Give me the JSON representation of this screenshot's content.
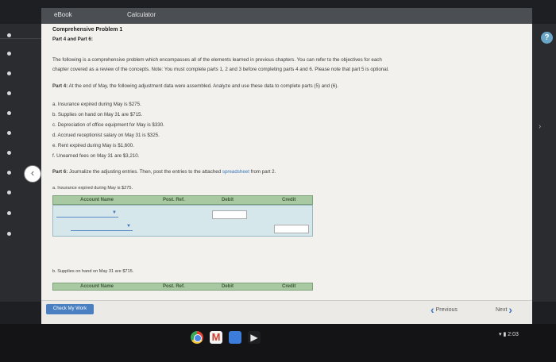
{
  "tabs": {
    "ebook": "eBook",
    "calculator": "Calculator"
  },
  "problem": {
    "title": "Comprehensive Problem 1",
    "subtitle": "Part 4 and Part 6:",
    "intro_line1": "The following is a comprehensive problem which encompasses all of the elements learned in previous chapters. You can refer to the objectives for each",
    "intro_line2": "chapter covered as a review of the concepts. Note: You must complete parts 1, 2 and 3 before completing parts 4 and 6. Please note that part 5 is optional.",
    "part4_label": "Part 4:",
    "part4_text": "At the end of May, the following adjustment data were assembled. Analyze and use these data to complete parts (5) and (6).",
    "items": [
      "a. Insurance expired during May is $275.",
      "b. Supplies on hand on May 31 are $715.",
      "c. Depreciation of office equipment for May is $330.",
      "d. Accrued receptionist salary on May 31 is $325.",
      "e. Rent expired during May is $1,600.",
      "f. Unearned fees on May 31 are $3,210."
    ],
    "part6_label": "Part 6:",
    "part6_text": "Journalize the adjusting entries. Then, post the entries to the attached",
    "part6_link": "spreadsheet",
    "part6_tail": "from part 2.",
    "entry_a": "a.  Insurance expired during May is $275.",
    "entry_b": "b.  Supplies on hand on May 31 are $715."
  },
  "table": {
    "account_name": "Account Name",
    "post_ref": "Post. Ref.",
    "debit": "Debit",
    "credit": "Credit"
  },
  "footer": {
    "check_label": "Check My Work",
    "previous_label": "Previous",
    "next_label": "Next"
  },
  "system": {
    "time": "2:03"
  },
  "colors": {
    "accent": "#4a7fc1",
    "table_header": "#a9c9a2",
    "table_body": "#d6e7ec"
  }
}
